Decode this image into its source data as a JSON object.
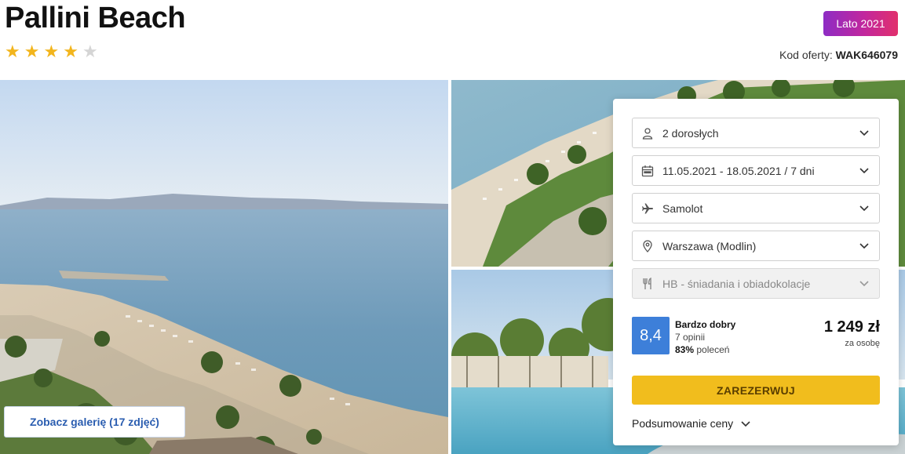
{
  "hotel": {
    "name": "Pallini Beach",
    "stars_filled": 4,
    "stars_total": 5
  },
  "season_badge": "Lato 2021",
  "offer_code": {
    "label": "Kod oferty:",
    "value": "WAK646079"
  },
  "gallery": {
    "button_label": "Zobacz galerię (17 zdjęć)"
  },
  "booking": {
    "fields": [
      {
        "icon": "person-icon",
        "value": "2 dorosłych",
        "disabled": false
      },
      {
        "icon": "calendar-icon",
        "value": "11.05.2021 - 18.05.2021 / 7 dni",
        "disabled": false
      },
      {
        "icon": "plane-icon",
        "value": "Samolot",
        "disabled": false
      },
      {
        "icon": "location-pin-icon",
        "value": "Warszawa (Modlin)",
        "disabled": false
      },
      {
        "icon": "cutlery-icon",
        "value": "HB - śniadania i obiadokolacje",
        "disabled": true
      }
    ],
    "rating": {
      "score": "8,4",
      "label": "Bardzo dobry",
      "reviews": "7 opinii",
      "recommend_pct": "83%",
      "recommend_text": "poleceń"
    },
    "price": {
      "amount": "1 249 zł",
      "per": "za osobę"
    },
    "reserve_label": "ZAREZERWUJ",
    "summary_label": "Podsumowanie ceny"
  },
  "colors": {
    "accent_blue": "#3d7fd9",
    "reserve_yellow": "#f1bd1d",
    "star_gold": "#f2b51d",
    "badge_gradient": [
      "#8e2cc4",
      "#e1306c"
    ]
  }
}
